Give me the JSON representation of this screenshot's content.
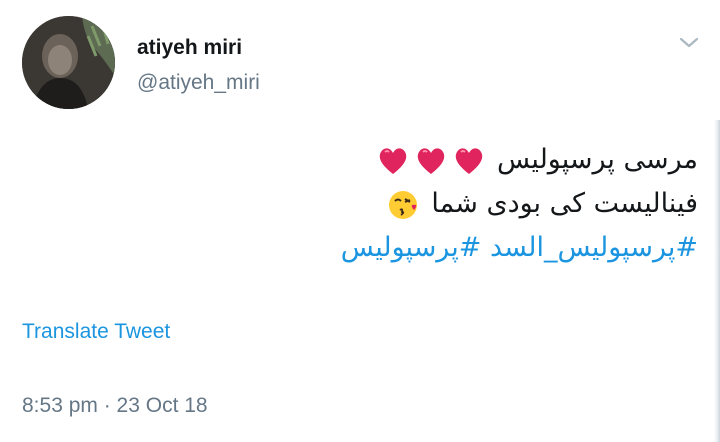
{
  "user": {
    "display_name": "atiyeh miri",
    "handle": "@atiyeh_miri"
  },
  "tweet": {
    "line1_text": "مرسی پرسپولیس",
    "line1_emoji": "heart-icon x3",
    "line2_text": "فینالیست کی بودی شما",
    "line2_emoji": "kissing-face-icon",
    "hashtags": [
      "#پرسپولیس_السد",
      "#پرسپولیس"
    ]
  },
  "actions": {
    "translate_label": "Translate Tweet"
  },
  "meta": {
    "timestamp": "8:53 pm · 23 Oct 18"
  },
  "colors": {
    "link": "#1b95e0",
    "secondary_text": "#657786",
    "primary_text": "#14171a",
    "heart": "#e0245e"
  }
}
